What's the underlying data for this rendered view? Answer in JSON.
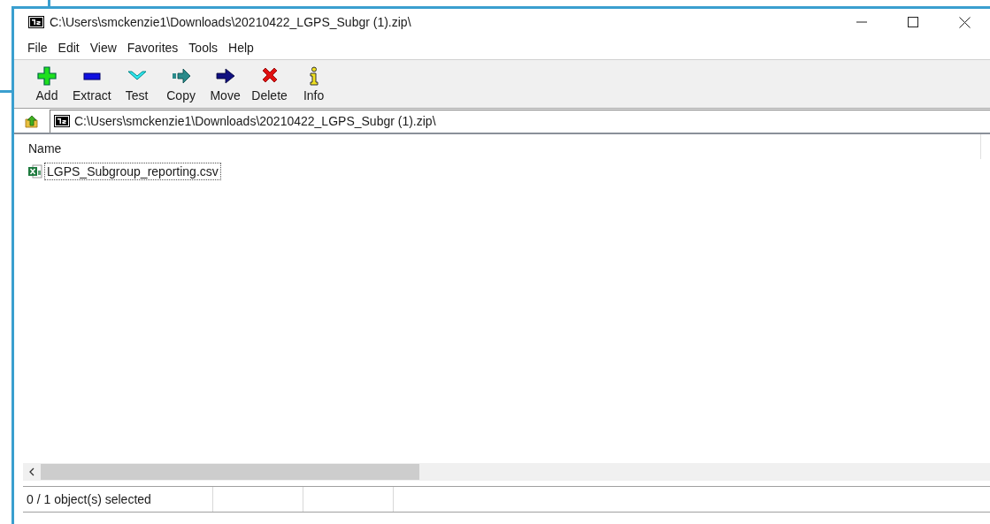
{
  "window": {
    "title": "C:\\Users\\smckenzie1\\Downloads\\20210422_LGPS_Subgr (1).zip\\"
  },
  "menu": [
    "File",
    "Edit",
    "View",
    "Favorites",
    "Tools",
    "Help"
  ],
  "toolbar": [
    {
      "label": "Add",
      "kind": "add"
    },
    {
      "label": "Extract",
      "kind": "extract"
    },
    {
      "label": "Test",
      "kind": "test"
    },
    {
      "label": "Copy",
      "kind": "copy"
    },
    {
      "label": "Move",
      "kind": "move"
    },
    {
      "label": "Delete",
      "kind": "delete"
    },
    {
      "label": "Info",
      "kind": "info"
    }
  ],
  "address": {
    "value": "C:\\Users\\smckenzie1\\Downloads\\20210422_LGPS_Subgr (1).zip\\"
  },
  "file_list": {
    "columns": [
      "Name"
    ],
    "rows": [
      {
        "name": "LGPS_Subgroup_reporting.csv",
        "focused": true
      }
    ]
  },
  "status_bar": {
    "sections": [
      "0 / 1 object(s) selected"
    ]
  }
}
